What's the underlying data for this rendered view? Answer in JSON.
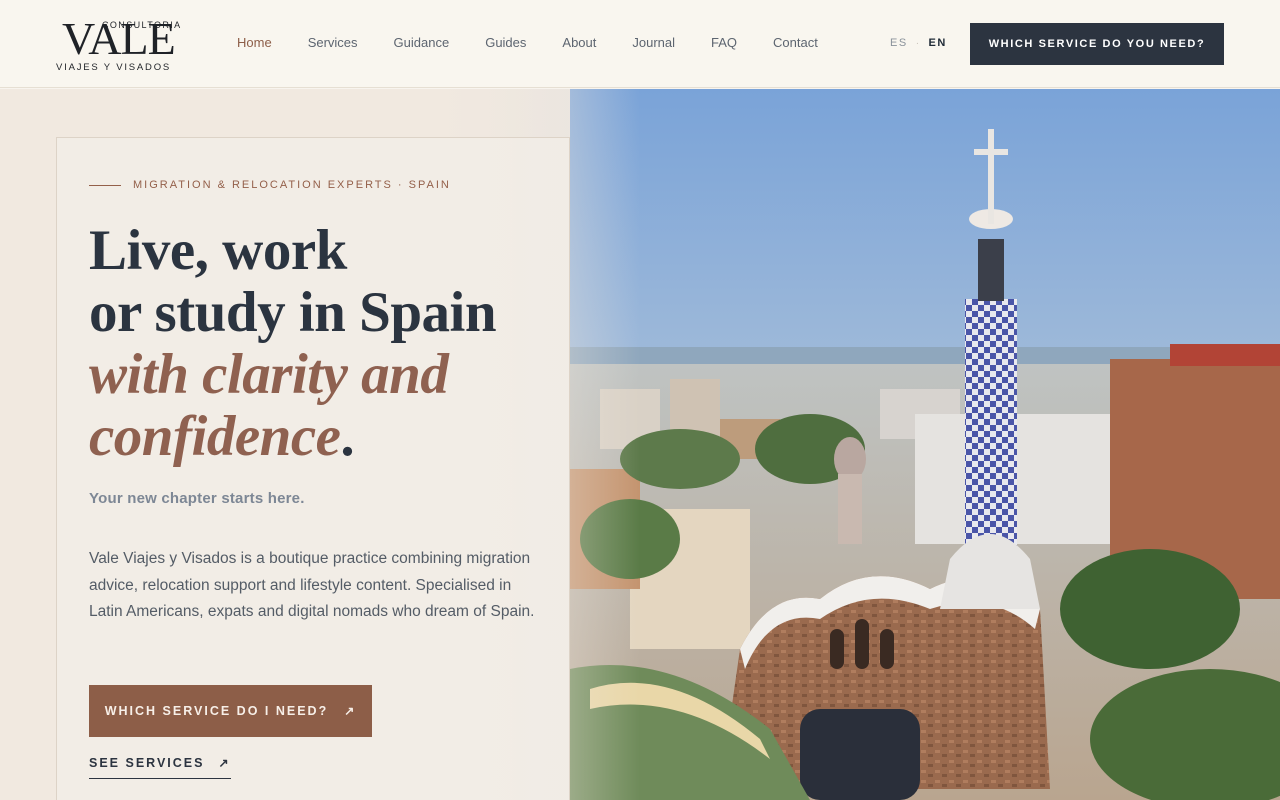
{
  "brand": {
    "name": "VALE",
    "tagline_top": "CONSULTORIA",
    "tagline_bottom": "VIAJES Y VISADOS"
  },
  "nav": {
    "items": [
      {
        "label": "Home",
        "active": true
      },
      {
        "label": "Services"
      },
      {
        "label": "Guidance"
      },
      {
        "label": "Guides"
      },
      {
        "label": "About"
      },
      {
        "label": "Journal"
      },
      {
        "label": "FAQ"
      },
      {
        "label": "Contact"
      }
    ]
  },
  "lang": {
    "es": "ES",
    "sep": "·",
    "en": "EN",
    "active": "EN"
  },
  "header_cta": "WHICH SERVICE DO YOU NEED?",
  "hero": {
    "eyebrow": "MIGRATION & RELOCATION EXPERTS · SPAIN",
    "headline_line1": "Live, work",
    "headline_line2": "or study in Spain",
    "headline_accent1": "with clarity and",
    "headline_accent2": "confidence",
    "headline_period": ".",
    "tagline": "Your new chapter starts here.",
    "description": "Vale Viajes y Visados is a boutique practice combining migration advice, relocation support and lifestyle content. Specialised in Latin Americans, expats and digital nomads who dream of Spain.",
    "cta_primary": "WHICH SERVICE DO I NEED?",
    "cta_secondary": "SEE SERVICES",
    "arrow": "↗"
  },
  "colors": {
    "accent": "#8d5e48",
    "dark": "#2c3440",
    "background": "#f9f6ef"
  }
}
